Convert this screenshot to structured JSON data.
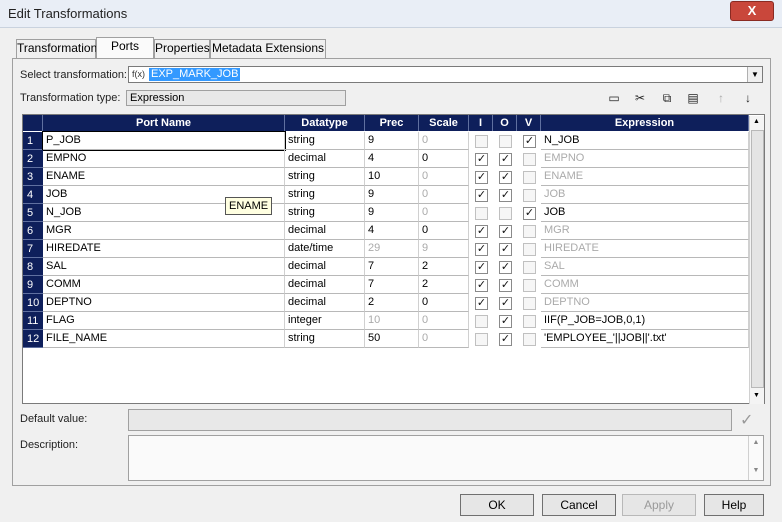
{
  "window": {
    "title": "Edit Transformations",
    "close_label": "X"
  },
  "tabs": [
    {
      "label": "Transformation"
    },
    {
      "label": "Ports"
    },
    {
      "label": "Properties"
    },
    {
      "label": "Metadata Extensions"
    }
  ],
  "select_transformation": {
    "label": "Select transformation:",
    "icon": "f(x)",
    "value": "EXP_MARK_JOB"
  },
  "transformation_type": {
    "label": "Transformation type:",
    "value": "Expression"
  },
  "toolbar_icons": [
    "new-port-icon",
    "cut-icon",
    "copy-icon",
    "paste-icon",
    "move-up-icon",
    "move-down-icon"
  ],
  "columns": [
    "Port Name",
    "Datatype",
    "Prec",
    "Scale",
    "I",
    "O",
    "V",
    "Expression"
  ],
  "rows": [
    {
      "num": "1",
      "name": "P_JOB",
      "type": "string",
      "prec": "9",
      "scale": "0",
      "i": false,
      "o": false,
      "v": true,
      "expr": "N_JOB",
      "prec_dim": false,
      "expr_dim": false
    },
    {
      "num": "2",
      "name": "EMPNO",
      "type": "decimal",
      "prec": "4",
      "scale": "0",
      "i": true,
      "o": true,
      "v": false,
      "expr": "EMPNO",
      "prec_dim": false,
      "expr_dim": true
    },
    {
      "num": "3",
      "name": "ENAME",
      "type": "string",
      "prec": "10",
      "scale": "0",
      "i": true,
      "o": true,
      "v": false,
      "expr": "ENAME",
      "prec_dim": false,
      "expr_dim": true
    },
    {
      "num": "4",
      "name": "JOB",
      "type": "string",
      "prec": "9",
      "scale": "0",
      "i": true,
      "o": true,
      "v": false,
      "expr": "JOB",
      "prec_dim": false,
      "expr_dim": true
    },
    {
      "num": "5",
      "name": "N_JOB",
      "type": "string",
      "prec": "9",
      "scale": "0",
      "i": false,
      "o": false,
      "v": true,
      "expr": "JOB",
      "prec_dim": false,
      "expr_dim": false
    },
    {
      "num": "6",
      "name": "MGR",
      "type": "decimal",
      "prec": "4",
      "scale": "0",
      "i": true,
      "o": true,
      "v": false,
      "expr": "MGR",
      "prec_dim": false,
      "expr_dim": true
    },
    {
      "num": "7",
      "name": "HIREDATE",
      "type": "date/time",
      "prec": "29",
      "scale": "9",
      "i": true,
      "o": true,
      "v": false,
      "expr": "HIREDATE",
      "prec_dim": true,
      "expr_dim": true
    },
    {
      "num": "8",
      "name": "SAL",
      "type": "decimal",
      "prec": "7",
      "scale": "2",
      "i": true,
      "o": true,
      "v": false,
      "expr": "SAL",
      "prec_dim": false,
      "expr_dim": true
    },
    {
      "num": "9",
      "name": "COMM",
      "type": "decimal",
      "prec": "7",
      "scale": "2",
      "i": true,
      "o": true,
      "v": false,
      "expr": "COMM",
      "prec_dim": false,
      "expr_dim": true
    },
    {
      "num": "10",
      "name": "DEPTNO",
      "type": "decimal",
      "prec": "2",
      "scale": "0",
      "i": true,
      "o": true,
      "v": false,
      "expr": "DEPTNO",
      "prec_dim": false,
      "expr_dim": true
    },
    {
      "num": "11",
      "name": "FLAG",
      "type": "integer",
      "prec": "10",
      "scale": "0",
      "i": false,
      "o": true,
      "v": false,
      "expr": "IIF(P_JOB=JOB,0,1)",
      "prec_dim": true,
      "expr_dim": false
    },
    {
      "num": "12",
      "name": "FILE_NAME",
      "type": "string",
      "prec": "50",
      "scale": "0",
      "i": false,
      "o": true,
      "v": false,
      "expr": "'EMPLOYEE_'||JOB||'.txt'",
      "prec_dim": false,
      "expr_dim": false
    }
  ],
  "tooltip": "ENAME",
  "default_value": {
    "label": "Default value:"
  },
  "description": {
    "label": "Description:"
  },
  "buttons": {
    "ok": "OK",
    "cancel": "Cancel",
    "apply": "Apply",
    "help": "Help"
  }
}
